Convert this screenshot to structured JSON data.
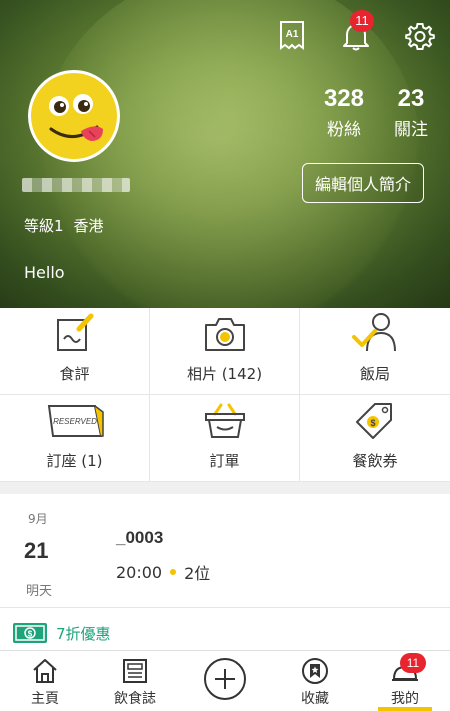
{
  "header": {
    "notification_count": "11",
    "level_label": "等級1",
    "location": "香港",
    "bio": "Hello",
    "followers_count": "328",
    "followers_label": "粉絲",
    "following_count": "23",
    "following_label": "關注",
    "edit_profile_label": "編輯個人簡介"
  },
  "grid": [
    {
      "label": "食評"
    },
    {
      "label": "相片 (142)"
    },
    {
      "label": "飯局"
    },
    {
      "label": "訂座 (1)"
    },
    {
      "label": "訂單"
    },
    {
      "label": "餐飲券"
    }
  ],
  "reservation": {
    "month": "9月",
    "day": "21",
    "relative_day": "明天",
    "restaurant_name": "_0003",
    "time": "20:00",
    "party_size": "2位"
  },
  "promo": {
    "text": "7折優惠"
  },
  "nav": {
    "items": [
      {
        "label": "主頁"
      },
      {
        "label": "飲食誌"
      },
      {
        "label": ""
      },
      {
        "label": "收藏"
      },
      {
        "label": "我的"
      }
    ],
    "profile_badge": "11"
  },
  "colors": {
    "accent": "#f5c400",
    "badge": "#e8242f",
    "promo_green": "#1fa37a"
  }
}
